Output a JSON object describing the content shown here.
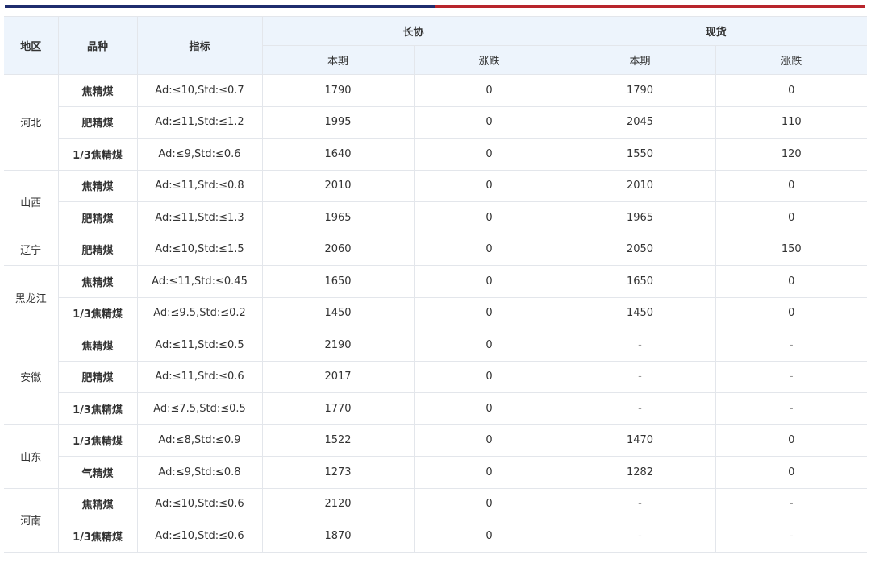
{
  "colors": {
    "accent_left": "#1f2d6e",
    "accent_right": "#b8252c",
    "header_bg": "#edf4fc"
  },
  "table": {
    "headers": {
      "region": "地区",
      "variety": "品种",
      "index": "指标",
      "long_contract": "长协",
      "spot": "现货",
      "current": "本期",
      "change": "涨跌"
    },
    "regions": [
      {
        "name": "河北",
        "rows": [
          {
            "variety": "焦精煤",
            "index": "Ad:≤10,Std:≤0.7",
            "lc_current": "1790",
            "lc_change": "0",
            "spot_current": "1790",
            "spot_change": "0"
          },
          {
            "variety": "肥精煤",
            "index": "Ad:≤11,Std:≤1.2",
            "lc_current": "1995",
            "lc_change": "0",
            "spot_current": "2045",
            "spot_change": "110"
          },
          {
            "variety": "1/3焦精煤",
            "index": "Ad:≤9,Std:≤0.6",
            "lc_current": "1640",
            "lc_change": "0",
            "spot_current": "1550",
            "spot_change": "120"
          }
        ]
      },
      {
        "name": "山西",
        "rows": [
          {
            "variety": "焦精煤",
            "index": "Ad:≤11,Std:≤0.8",
            "lc_current": "2010",
            "lc_change": "0",
            "spot_current": "2010",
            "spot_change": "0"
          },
          {
            "variety": "肥精煤",
            "index": "Ad:≤11,Std:≤1.3",
            "lc_current": "1965",
            "lc_change": "0",
            "spot_current": "1965",
            "spot_change": "0"
          }
        ]
      },
      {
        "name": "辽宁",
        "rows": [
          {
            "variety": "肥精煤",
            "index": "Ad:≤10,Std:≤1.5",
            "lc_current": "2060",
            "lc_change": "0",
            "spot_current": "2050",
            "spot_change": "150"
          }
        ]
      },
      {
        "name": "黑龙江",
        "rows": [
          {
            "variety": "焦精煤",
            "index": "Ad:≤11,Std:≤0.45",
            "lc_current": "1650",
            "lc_change": "0",
            "spot_current": "1650",
            "spot_change": "0"
          },
          {
            "variety": "1/3焦精煤",
            "index": "Ad:≤9.5,Std:≤0.2",
            "lc_current": "1450",
            "lc_change": "0",
            "spot_current": "1450",
            "spot_change": "0"
          }
        ]
      },
      {
        "name": "安徽",
        "rows": [
          {
            "variety": "焦精煤",
            "index": "Ad:≤11,Std:≤0.5",
            "lc_current": "2190",
            "lc_change": "0",
            "spot_current": "-",
            "spot_change": "-"
          },
          {
            "variety": "肥精煤",
            "index": "Ad:≤11,Std:≤0.6",
            "lc_current": "2017",
            "lc_change": "0",
            "spot_current": "-",
            "spot_change": "-"
          },
          {
            "variety": "1/3焦精煤",
            "index": "Ad:≤7.5,Std:≤0.5",
            "lc_current": "1770",
            "lc_change": "0",
            "spot_current": "-",
            "spot_change": "-"
          }
        ]
      },
      {
        "name": "山东",
        "rows": [
          {
            "variety": "1/3焦精煤",
            "index": "Ad:≤8,Std:≤0.9",
            "lc_current": "1522",
            "lc_change": "0",
            "spot_current": "1470",
            "spot_change": "0"
          },
          {
            "variety": "气精煤",
            "index": "Ad:≤9,Std:≤0.8",
            "lc_current": "1273",
            "lc_change": "0",
            "spot_current": "1282",
            "spot_change": "0"
          }
        ]
      },
      {
        "name": "河南",
        "rows": [
          {
            "variety": "焦精煤",
            "index": "Ad:≤10,Std:≤0.6",
            "lc_current": "2120",
            "lc_change": "0",
            "spot_current": "-",
            "spot_change": "-"
          },
          {
            "variety": "1/3焦精煤",
            "index": "Ad:≤10,Std:≤0.6",
            "lc_current": "1870",
            "lc_change": "0",
            "spot_current": "-",
            "spot_change": "-"
          }
        ]
      }
    ]
  }
}
